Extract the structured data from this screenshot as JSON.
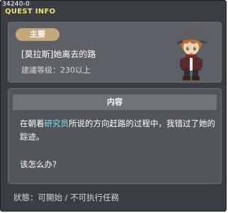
{
  "quest_id": "34240-0",
  "window_title": "QUEST INFO",
  "header": {
    "badge": "主要",
    "quest_name": "[莫拉斯]她离去的路",
    "level_requirement": "建議等级：230以上"
  },
  "npc": {
    "icon": "npc-portrait-boy-with-cap",
    "colors": {
      "hair": "#b8703a",
      "cap": "#5e5d62",
      "jacket": "#5a2b2b",
      "skin": "#f4d3b3"
    }
  },
  "content": {
    "header": "内容",
    "text_before": "在朝着",
    "text_highlight": "研究员",
    "text_after": "所说的方向赶路的过程中，我错过了她的踪迹。",
    "text2": "该怎么办?"
  },
  "status": {
    "label": "狀態：",
    "value": "可開始 / 不可执行任務"
  },
  "colors": {
    "window_bg": "#3a3d42",
    "title": "#f3e07a",
    "badge_bg": "#c4a77c",
    "highlight": "#7fe0ef"
  }
}
